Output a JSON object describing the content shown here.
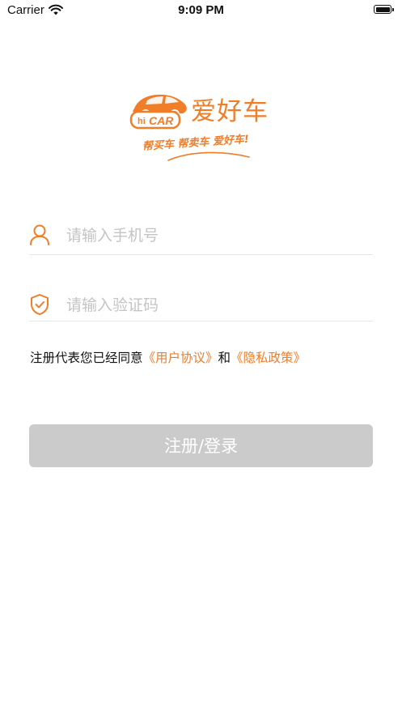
{
  "status_bar": {
    "carrier": "Carrier",
    "time": "9:09 PM"
  },
  "logo": {
    "brand_name": "爱好车",
    "badge_text": "CAR",
    "slogan": "帮买车 帮卖车 爱好车!"
  },
  "form": {
    "phone": {
      "placeholder": "请输入手机号",
      "value": "",
      "icon": "user-icon"
    },
    "code": {
      "placeholder": "请输入验证码",
      "value": "",
      "icon": "shield-check-icon"
    }
  },
  "agreement": {
    "prefix": "注册代表您已经同意",
    "user_agreement": "《用户协议》",
    "joiner": "和",
    "privacy_policy": "《隐私政策》"
  },
  "submit": {
    "label": "注册/登录"
  },
  "colors": {
    "accent": "#f07d28",
    "button_disabled": "#cbcbcb",
    "placeholder": "#c4c4c4",
    "divider": "#e6e6e6"
  }
}
